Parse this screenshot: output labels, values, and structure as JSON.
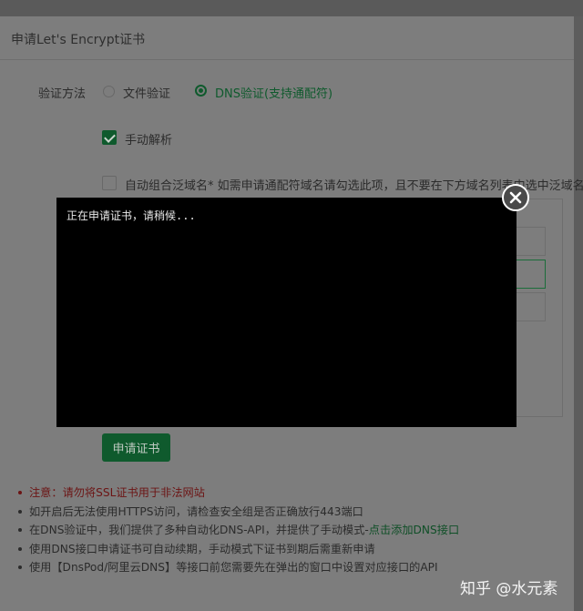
{
  "dialog": {
    "title": "申请Let's Encrypt证书"
  },
  "verify": {
    "label": "验证方法",
    "options": [
      {
        "label": "文件验证",
        "selected": false
      },
      {
        "label": "DNS验证(支持通配符)",
        "selected": true
      }
    ]
  },
  "manual_resolve": {
    "label": "手动解析",
    "checked": true
  },
  "auto_wildcard": {
    "label": "自动组合泛域名* 如需申请通配符域名请勾选此项，且不要在下方域名列表中选中泛域名",
    "checked": false
  },
  "apply_button": {
    "label": "申请证书"
  },
  "notes": {
    "warning_prefix": "注意：",
    "warning_text": "请勿将SSL证书用于非法网站",
    "line2": "如开启后无法使用HTTPS访问，请检查安全组是否正确放行443端口",
    "line3_text": "在DNS验证中，我们提供了多种自动化DNS-API，并提供了手动模式-",
    "line3_link": "点击添加DNS接口",
    "line4": "使用DNS接口申请证书可自动续期，手动模式下证书到期后需重新申请",
    "line5": "使用【DnsPod/阿里云DNS】等接口前您需要先在弹出的窗口中设置对应接口的API"
  },
  "console": {
    "text": "正在申请证书，请稍候..."
  },
  "watermark": {
    "text": "知乎 @水元素"
  },
  "colors": {
    "accent": "#0f5a2d",
    "warning": "#6c1414",
    "console_bg": "#000000"
  }
}
